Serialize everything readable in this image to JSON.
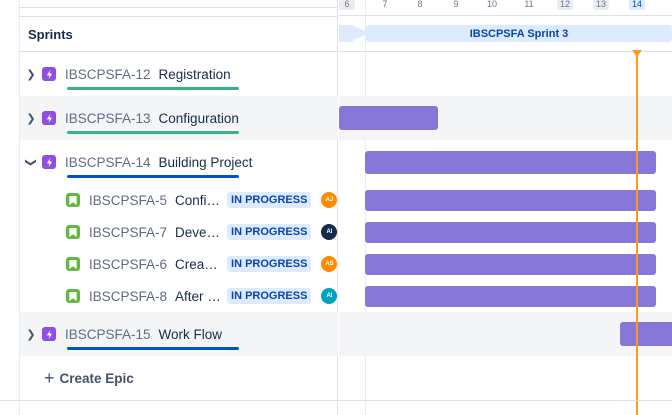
{
  "sidebar": {
    "title": "Sprints"
  },
  "timeline": {
    "days": [
      "6",
      "7",
      "8",
      "9",
      "10",
      "11",
      "12",
      "13",
      "14"
    ],
    "sprint_label": "IBSCPSFA Sprint 3"
  },
  "epics": [
    {
      "key": "IBSCPSFA-12",
      "summary": "Registration",
      "progress_color": "#36b37e"
    },
    {
      "key": "IBSCPSFA-13",
      "summary": "Configuration",
      "progress_color": "#36b37e"
    },
    {
      "key": "IBSCPSFA-14",
      "summary": "Building Project",
      "progress_color": "#0052cc"
    },
    {
      "key": "IBSCPSFA-15",
      "summary": "Work Flow",
      "progress_color": "#0052cc"
    }
  ],
  "stories": [
    {
      "key": "IBSCPSFA-5",
      "summary": "Confi…",
      "status": "IN PROGRESS",
      "assignee": "AJ",
      "avatar_color": "#ff8b00"
    },
    {
      "key": "IBSCPSFA-7",
      "summary": "Devel…",
      "status": "IN PROGRESS",
      "assignee": "AI",
      "avatar_color": "#172b4d"
    },
    {
      "key": "IBSCPSFA-6",
      "summary": "Creat…",
      "status": "IN PROGRESS",
      "assignee": "AS",
      "avatar_color": "#ff8b00"
    },
    {
      "key": "IBSCPSFA-8",
      "summary": "After …",
      "status": "IN PROGRESS",
      "assignee": "AI",
      "avatar_color": "#00a3bf"
    }
  ],
  "create_epic_label": "Create Epic",
  "colors": {
    "accent": "#0052cc",
    "bar": "#8777d9",
    "today_marker": "#ff991f"
  }
}
